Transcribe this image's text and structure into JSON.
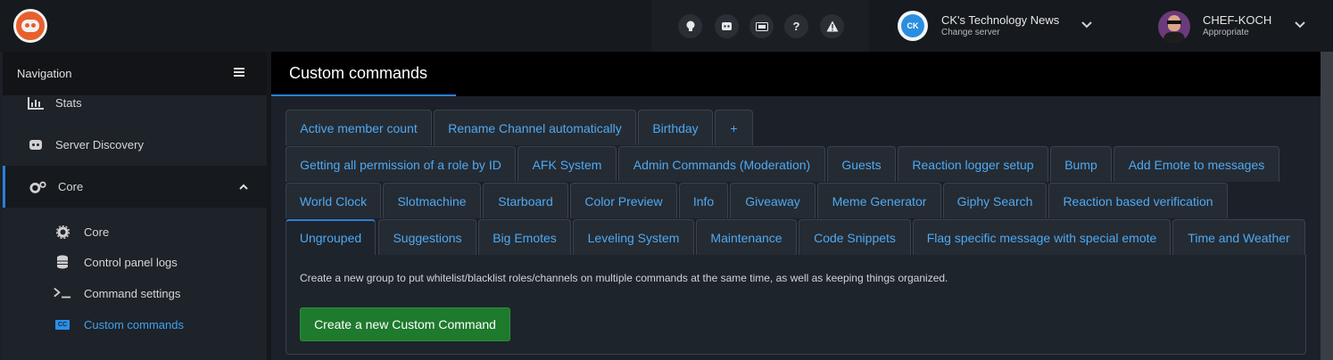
{
  "topbar": {
    "icons": [
      "lightbulb-icon",
      "discord-icon",
      "ticket-icon",
      "help-icon",
      "warning-icon"
    ],
    "help_glyph": "?",
    "warning_glyph": "!"
  },
  "server": {
    "avatar_text": "CK",
    "name": "CK's Technology News",
    "subtitle": "Change server"
  },
  "user": {
    "name": "CHEF-KOCH",
    "role": "Appropriate"
  },
  "sidebar": {
    "title": "Navigation",
    "items": [
      {
        "label": "Stats",
        "icon": "bar-chart-icon"
      },
      {
        "label": "Server Discovery",
        "icon": "discord-icon"
      },
      {
        "label": "Core",
        "icon": "gears-icon"
      }
    ],
    "subitems": [
      {
        "label": "Core",
        "icon": "gear-icon"
      },
      {
        "label": "Control panel logs",
        "icon": "database-icon"
      },
      {
        "label": "Command settings",
        "icon": "terminal-icon"
      },
      {
        "label": "Custom commands",
        "icon": "cc-icon",
        "badge": "CC"
      }
    ]
  },
  "page": {
    "title": "Custom commands"
  },
  "tabs": {
    "row1": [
      "Active member count",
      "Rename Channel automatically",
      "Birthday",
      "+"
    ],
    "row2": [
      "Getting all permission of a role by ID",
      "AFK System",
      "Admin Commands (Moderation)",
      "Guests",
      "Reaction logger setup",
      "Bump",
      "Add Emote to messages"
    ],
    "row3": [
      "World Clock",
      "Slotmachine",
      "Starboard",
      "Color Preview",
      "Info",
      "Giveaway",
      "Meme Generator",
      "Giphy Search",
      "Reaction based verification"
    ],
    "row4": [
      "Ungrouped",
      "Suggestions",
      "Big Emotes",
      "Leveling System",
      "Maintenance",
      "Code Snippets",
      "Flag specific message with special emote",
      "Time and Weather"
    ],
    "active": "Ungrouped"
  },
  "panel": {
    "description": "Create a new group to put whitelist/blacklist roles/channels on multiple commands at the same time, as well as keeping things organized.",
    "create_button": "Create a new Custom Command"
  },
  "colors": {
    "accent": "#2b7fd6",
    "tab_text": "#4ea9f2",
    "button": "#1e7a2c"
  }
}
